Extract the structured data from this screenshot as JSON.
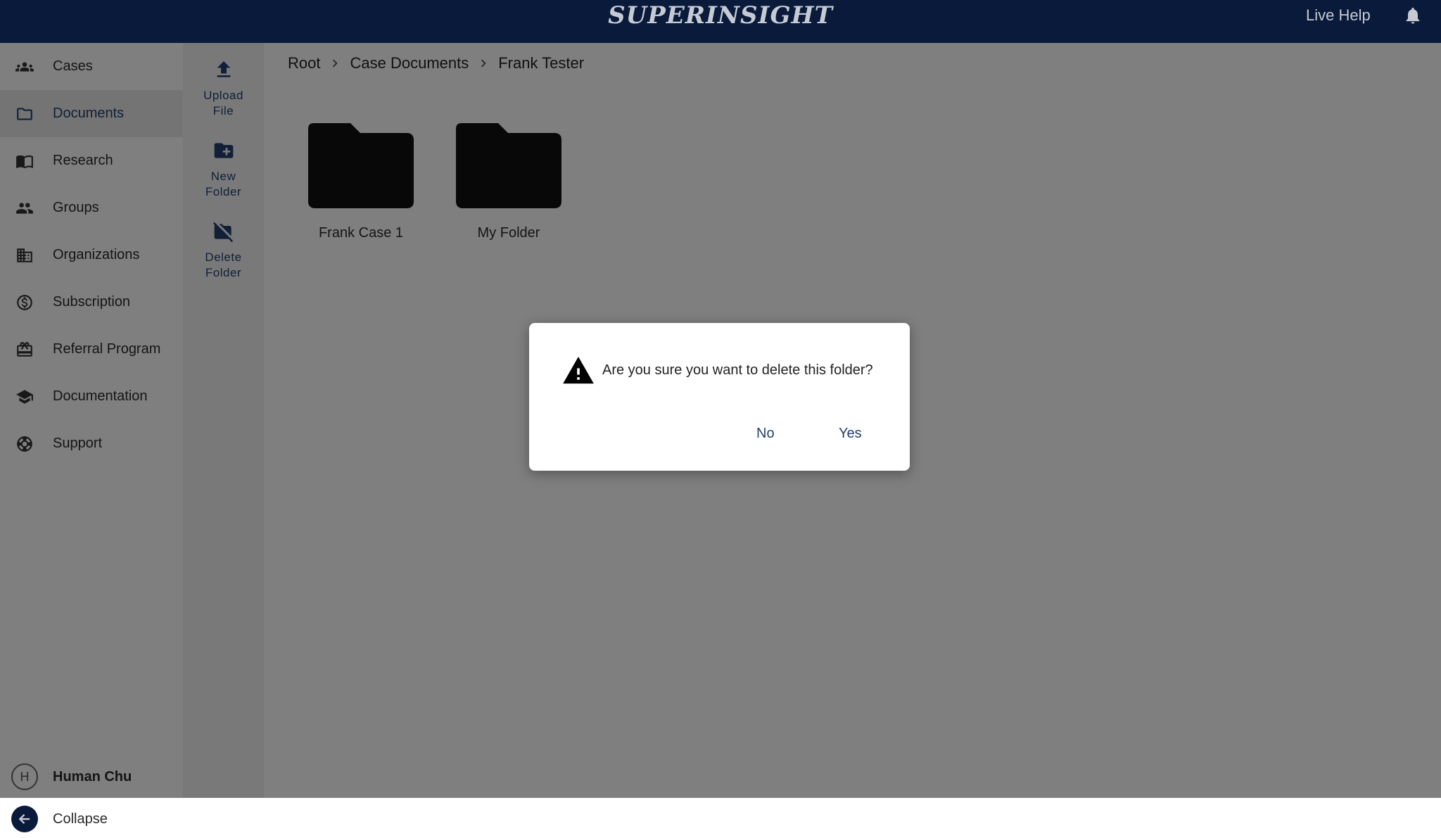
{
  "app": {
    "logo_text": "SUPERINSIGHT",
    "live_help": "Live Help"
  },
  "sidebar": {
    "items": [
      {
        "label": "Cases",
        "icon": "people-group-icon"
      },
      {
        "label": "Documents",
        "icon": "folder-icon",
        "active": true
      },
      {
        "label": "Research",
        "icon": "book-open-icon"
      },
      {
        "label": "Groups",
        "icon": "groups-icon"
      },
      {
        "label": "Organizations",
        "icon": "building-icon"
      },
      {
        "label": "Subscription",
        "icon": "dollar-circle-icon"
      },
      {
        "label": "Referral Program",
        "icon": "gift-card-icon"
      },
      {
        "label": "Documentation",
        "icon": "graduation-cap-icon"
      },
      {
        "label": "Support",
        "icon": "lifebuoy-icon"
      }
    ],
    "user": {
      "initial": "H",
      "name": "Human Chu"
    },
    "collapse_label": "Collapse"
  },
  "tools": {
    "upload": "Upload\nFile",
    "new_folder": "New\nFolder",
    "delete_folder": "Delete\nFolder"
  },
  "breadcrumb": [
    "Root",
    "Case Documents",
    "Frank Tester"
  ],
  "folders": [
    {
      "name": "Frank Case 1"
    },
    {
      "name": "My Folder"
    }
  ],
  "dialog": {
    "message": "Are you sure you want to delete this folder?",
    "no_label": "No",
    "yes_label": "Yes"
  },
  "colors": {
    "topbar": "#0a1a3a",
    "accent": "#23406e",
    "overlay": "rgba(0,0,0,0.5)"
  }
}
